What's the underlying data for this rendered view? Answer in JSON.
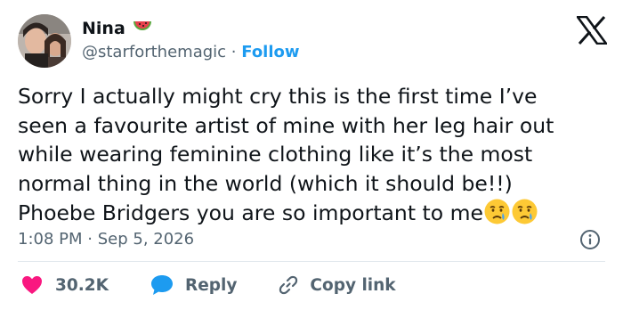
{
  "author": {
    "name": "Nina",
    "name_emoji_icon": "watermelon-icon",
    "handle": "@starforthemagic",
    "separator": "·",
    "follow_label": "Follow",
    "avatar_icon": "profile-photo"
  },
  "platform_icon": "x-logo-icon",
  "tweet": {
    "lines": [
      "Sorry I actually might cry this is the first time I’ve",
      "seen a favourite artist of mine with her leg hair out",
      "while wearing feminine clothing like it’s the most",
      "normal thing in the world (which it should be!!)",
      "Phoebe Bridgers you are so important to me"
    ],
    "trailing_emoji_icons": [
      "crying-face-icon",
      "crying-face-icon"
    ]
  },
  "meta": {
    "time": "1:08 PM",
    "separator": "·",
    "date": "Sep 5, 2026",
    "info_icon": "info-icon"
  },
  "actions": {
    "like_count": "30.2K",
    "reply_label": "Reply",
    "copy_link_label": "Copy link"
  },
  "colors": {
    "text": "#0f1419",
    "secondary": "#536471",
    "accent": "#1d9bf0",
    "like": "#f91880",
    "divider": "#e1e8ed"
  }
}
